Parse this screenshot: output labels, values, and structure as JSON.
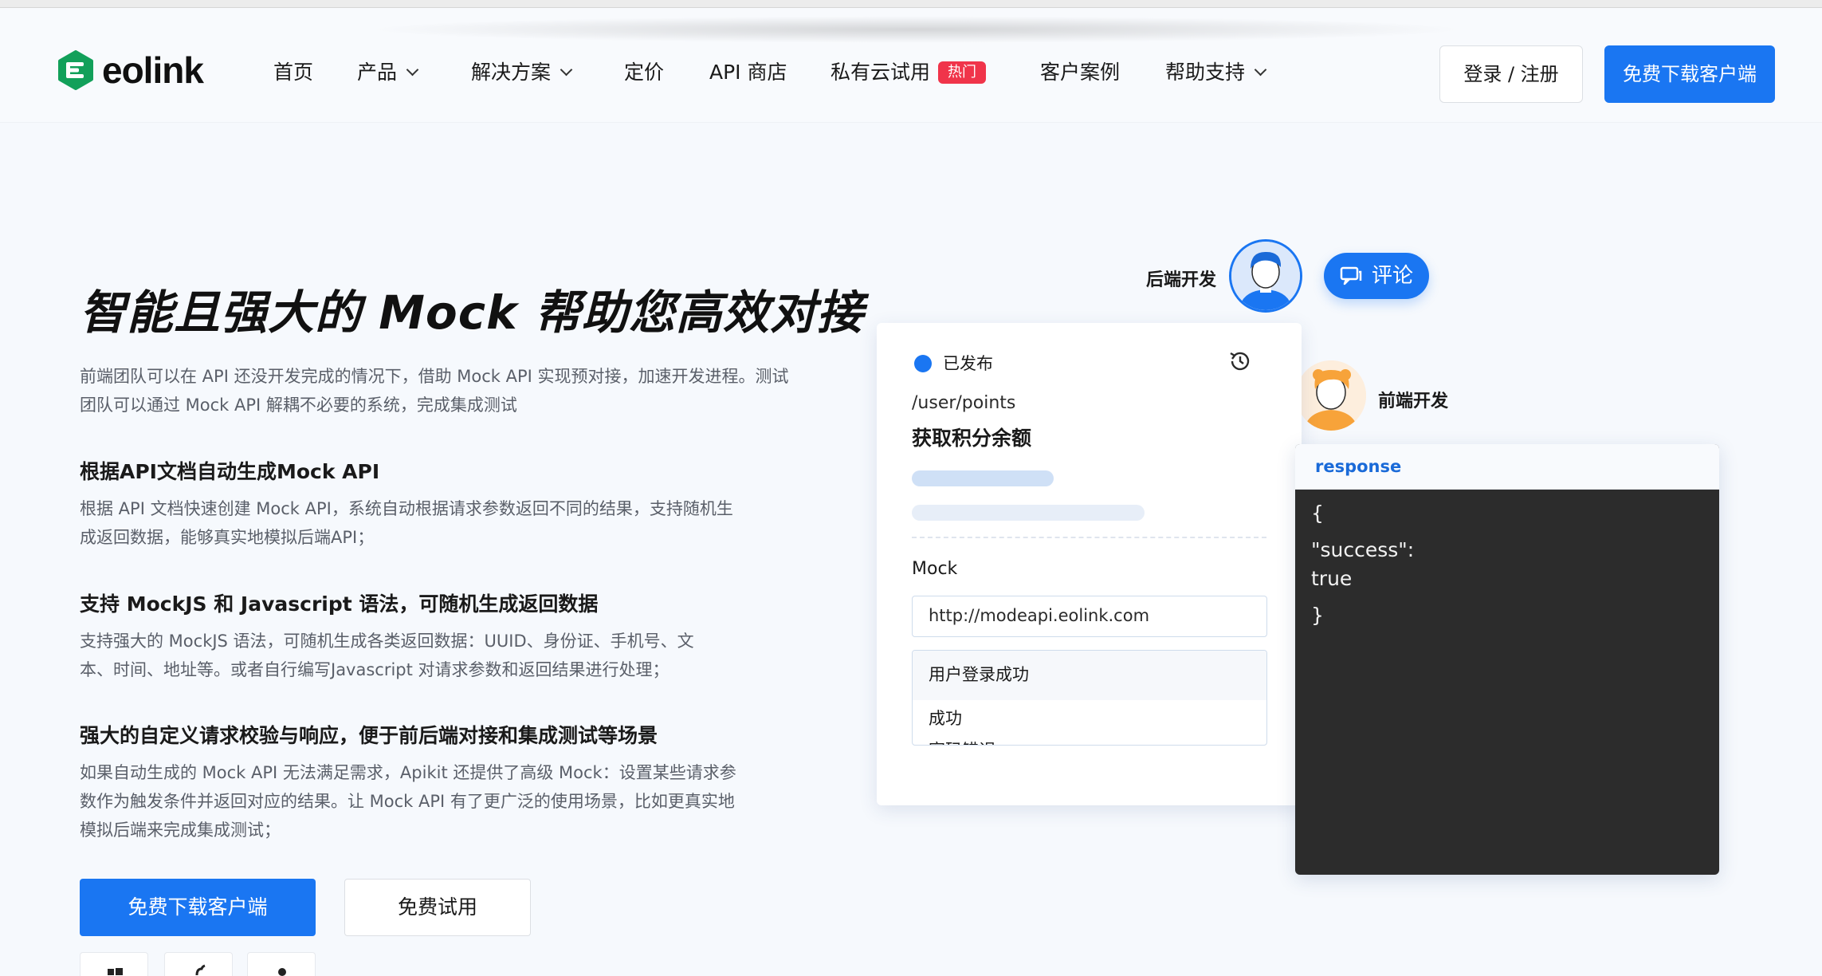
{
  "header": {
    "logo_text": "eolink",
    "nav": [
      {
        "label": "首页",
        "dropdown": false
      },
      {
        "label": "产品",
        "dropdown": true
      },
      {
        "label": "解决方案",
        "dropdown": true
      },
      {
        "label": "定价",
        "dropdown": false
      },
      {
        "label": "API 商店",
        "dropdown": false
      },
      {
        "label": "私有云试用",
        "dropdown": false,
        "badge": "热门"
      },
      {
        "label": "客户案例",
        "dropdown": false
      },
      {
        "label": "帮助支持",
        "dropdown": true
      }
    ],
    "login_label": "登录 / 注册",
    "download_label": "免费下载客户端"
  },
  "hero": {
    "title": "智能且强大的 Mock 帮助您高效对接",
    "intro": "前端团队可以在 API 还没开发完成的情况下，借助 Mock API 实现预对接，加速开发进程。测试团队可以通过 Mock API 解耦不必要的系统，完成集成测试",
    "features": [
      {
        "title": "根据API文档自动生成Mock API",
        "desc": "根据 API 文档快速创建 Mock API，系统自动根据请求参数返回不同的结果，支持随机生成返回数据，能够真实地模拟后端API；"
      },
      {
        "title": "支持 MockJS 和 Javascript 语法，可随机生成返回数据",
        "desc": "支持强大的 MockJS 语法，可随机生成各类返回数据：UUID、身份证、手机号、文本、时间、地址等。或者自行编写Javascript 对请求参数和返回结果进行处理；"
      },
      {
        "title": "强大的自定义请求校验与响应，便于前后端对接和集成测试等场景",
        "desc": "如果自动生成的 Mock API 无法满足需求，Apikit 还提供了高级 Mock：设置某些请求参数作为触发条件并返回对应的结果。让 Mock API 有了更广泛的使用场景，比如更真实地模拟后端来完成集成测试；"
      }
    ],
    "cta_primary": "免费下载客户端",
    "cta_secondary": "免费试用"
  },
  "illustration": {
    "backend_label": "后端开发",
    "frontend_label": "前端开发",
    "comment_label": "评论",
    "card": {
      "status": "已发布",
      "path": "/user/points",
      "name": "获取积分余额",
      "mock_label": "Mock",
      "mock_url": "http://modeapi.eolink.com",
      "options": [
        "用户登录成功",
        "成功",
        "密码错误"
      ]
    },
    "response": {
      "header": "response",
      "lines": [
        "{",
        "\"success\":",
        "true",
        "}"
      ]
    }
  },
  "colors": {
    "brand": "#1a76f2",
    "logo_green": "#12a05a",
    "hot_badge": "#f0344a",
    "code_bg": "#2c2c2c"
  }
}
